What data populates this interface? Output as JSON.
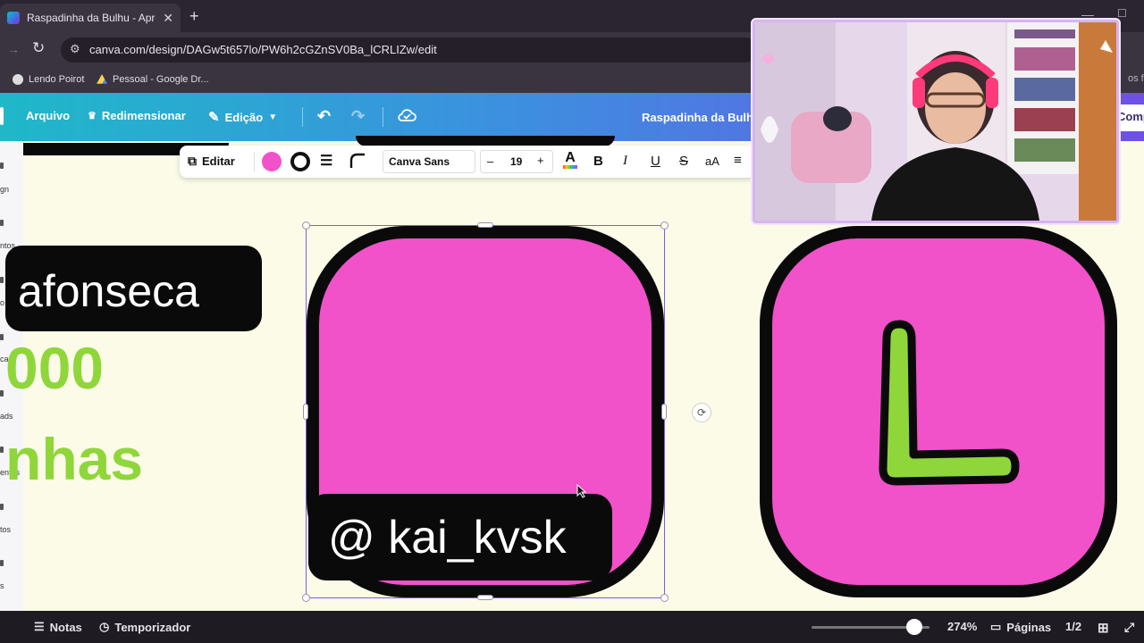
{
  "browser": {
    "tab_title": "Raspadinha da Bulhu - Apresen",
    "tab_close": "✕",
    "new_tab": "+",
    "url": "canva.com/design/DAGw5t657lo/PW6h2cGZnSV0Ba_lCRLIZw/edit",
    "bookmarks": [
      {
        "label": "Lendo Poirot",
        "color": "#e8e3ee"
      },
      {
        "label": "Pessoal - Google Dr...",
        "color": "#f4b400"
      }
    ],
    "bookmarks_overflow": "os fave"
  },
  "canva_header": {
    "file_label": "Arquivo",
    "resize_label": "Redimensionar",
    "edit_label": "Edição",
    "project_title": "Raspadinha da Bulhu",
    "share_label": "Compartilhar"
  },
  "left_rail": {
    "labels": [
      "gn",
      "ntos",
      "o",
      "ca",
      "ads",
      "entas",
      "tos",
      "s"
    ]
  },
  "text_toolbar": {
    "edit_label": "Editar",
    "font_name": "Canva Sans",
    "font_size": "19",
    "minus": "–",
    "plus": "+",
    "bold": "B",
    "italic": "I",
    "underline": "U",
    "strike": "S",
    "case": "aA",
    "fill_color": "#f151c9"
  },
  "canvas": {
    "username_partial": "afonseca",
    "count_partial": "000",
    "unit_partial": "nhas",
    "card1_tag": "@ kai_kvsk",
    "card2_letter": "L",
    "card_color": "#f151c9",
    "letter_color": "#8fd63b"
  },
  "footer": {
    "notes_label": "Notas",
    "timer_label": "Temporizador",
    "zoom": "274%",
    "zoom_level": 0.8,
    "pages_label": "Páginas",
    "page_indicator": "1/2"
  }
}
